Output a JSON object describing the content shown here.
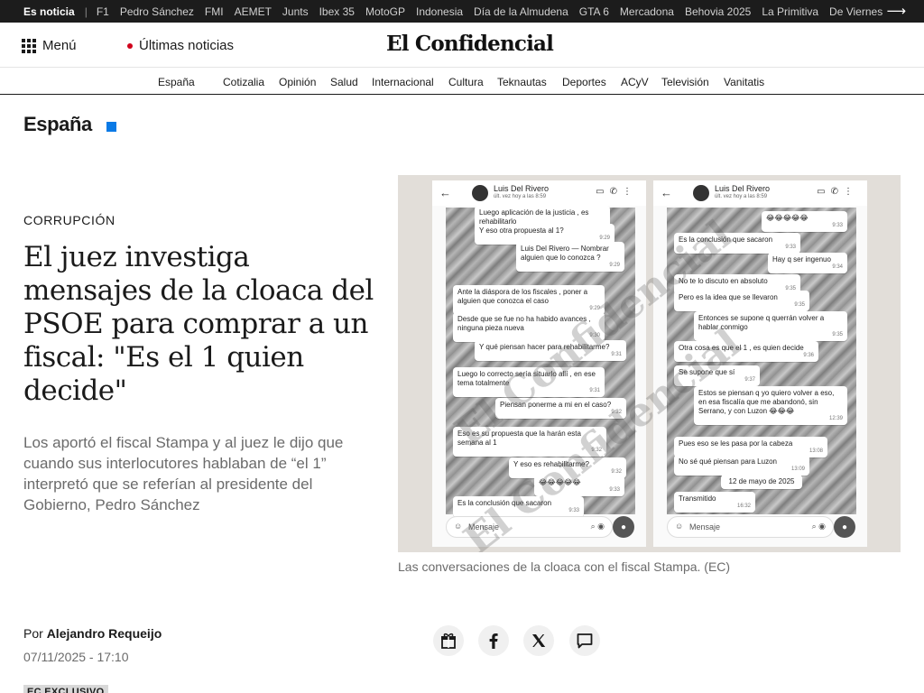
{
  "topbar": {
    "lead": "Es noticia",
    "items": [
      "F1",
      "Pedro Sánchez",
      "FMI",
      "AEMET",
      "Junts",
      "Ibex 35",
      "MotoGP",
      "Indonesia",
      "Día de la Almudena",
      "GTA 6",
      "Mercadona",
      "Behovia 2025",
      "La Primitiva",
      "De Viernes"
    ],
    "more_icon": "arrow-right-icon"
  },
  "header": {
    "menu_label": "Menú",
    "latest_label": "Últimas noticias",
    "logo": "El Confidencial"
  },
  "nav": {
    "items": [
      "España",
      "Cotizalia",
      "Opinión",
      "Salud",
      "Internacional",
      "Cultura",
      "Teknautas",
      "Deportes",
      "ACyV",
      "Televisión",
      "Vanitatis"
    ]
  },
  "section": {
    "title": "España",
    "accent_color": "#0a7ae6"
  },
  "article": {
    "kicker": "CORRUPCIÓN",
    "headline": "El juez investiga mensajes de la cloaca del PSOE para comprar a un fiscal: \"Es el 1 quien decide\"",
    "subhead": "Los aportó el fiscal Stampa y al juez le dijo que cuando sus interlocutores hablaban de “el 1” interpretó que se referían al presidente del Gobierno, Pedro Sánchez",
    "byline_prefix": "Por",
    "author": "Alejandro Requeijo",
    "date": "07/11/2025 - 17:10",
    "badge": "EC EXCLUSIVO",
    "caption": "Las conversaciones de la cloaca con el fiscal Stampa. (EC)"
  },
  "share": [
    "gift-icon",
    "facebook-icon",
    "x-icon",
    "comment-icon"
  ],
  "figure": {
    "contact_name": "Luis Del Rivero",
    "contact_status": "últ. vez hoy a las 8:59",
    "input_placeholder": "Mensaje",
    "watermark": "El Confidencial",
    "left_messages": [
      {
        "text": "Luego aplicación de la justicia , es rehabilitarlo",
        "time": ""
      },
      {
        "text": "Y eso otra propuesta al 1?",
        "time": "9:29"
      },
      {
        "text": "Luis Del Rivero — Nombrar alguien que lo conozca ?",
        "time": "9:29"
      },
      {
        "text": "Ante la diáspora de los fiscales , poner a alguien que conozca el caso",
        "time": "9:29"
      },
      {
        "text": "Desde que se fue no ha habido avances , ninguna pieza nueva",
        "time": "9:30"
      },
      {
        "text": "Y qué piensan hacer para rehabilitarme?",
        "time": "9:31"
      },
      {
        "text": "Luego lo correcto sería situarlo allí , en ese tema totalmente",
        "time": "9:31"
      },
      {
        "text": "Piensan ponerme a mi en el caso?",
        "time": "9:32"
      },
      {
        "text": "Eso es su propuesta que la harán esta semana al 1",
        "time": "9:32"
      },
      {
        "text": "Y eso es rehabilitarme?",
        "time": "9:32"
      },
      {
        "text": "😂😂😂😂😂",
        "time": "9:33"
      },
      {
        "text": "Es la conclusión que sacaron",
        "time": "9:33"
      }
    ],
    "right_messages": [
      {
        "text": "😂😂😂😂😂",
        "time": "9:33"
      },
      {
        "text": "Es la conclusión que sacaron",
        "time": "9:33"
      },
      {
        "text": "Hay q ser ingenuo",
        "time": "9:34"
      },
      {
        "text": "No te lo discuto en absoluto",
        "time": "9:35"
      },
      {
        "text": "Pero es la idea que se llevaron",
        "time": "9:35"
      },
      {
        "text": "Entonces se supone q querrán volver a hablar conmigo",
        "time": "9:35"
      },
      {
        "text": "Otra cosa es que el 1 , es quien decide",
        "time": "9:36"
      },
      {
        "text": "Se supone que sí",
        "time": "9:37"
      },
      {
        "text": "Estos se piensan q yo quiero volver a eso, en esa fiscalía que me abandonó, sin Serrano, y con Luzon 😂😂😂",
        "time": "12:39"
      },
      {
        "text": "Pues eso se les pasa por la cabeza",
        "time": "13:08"
      },
      {
        "text": "No sé qué piensan para Luzon",
        "time": "13:09"
      },
      {
        "text": "12 de mayo de 2025",
        "time": ""
      },
      {
        "text": "Transmitido",
        "time": "16:32"
      }
    ]
  }
}
